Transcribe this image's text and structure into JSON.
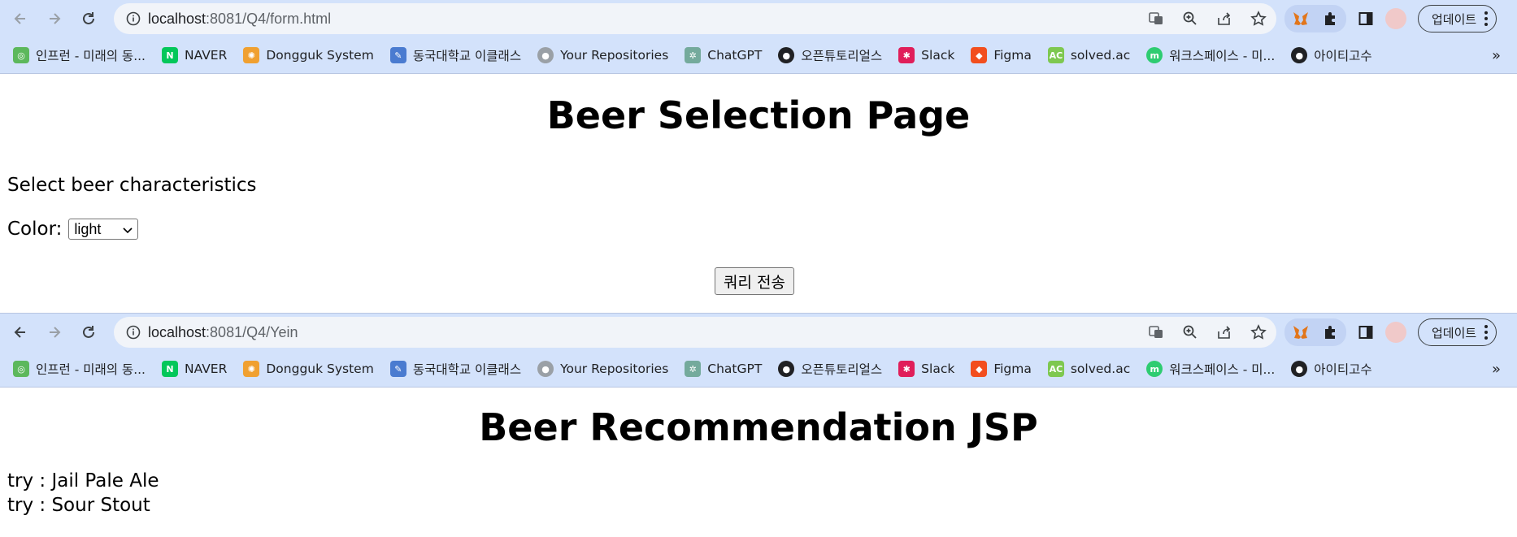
{
  "window1": {
    "url_host": "localhost",
    "url_path": ":8081/Q4/form.html",
    "update_label": "업데이트",
    "page": {
      "heading": "Beer Selection Page",
      "lead": "Select beer characteristics",
      "color_label": "Color:",
      "color_value": "light",
      "submit_label": "쿼리 전송"
    }
  },
  "window2": {
    "url_host": "localhost",
    "url_path": ":8081/Q4/Yein",
    "update_label": "업데이트",
    "page": {
      "heading": "Beer Recommendation JSP",
      "results": [
        "try : Jail Pale Ale",
        "try : Sour Stout"
      ]
    }
  },
  "bookmarks": [
    {
      "label": "인프런 - 미래의 동...",
      "icon": "inflearn-icon",
      "color": "#5cb85c"
    },
    {
      "label": "NAVER",
      "icon": "naver-icon",
      "color": "#03c75a"
    },
    {
      "label": "Dongguk System",
      "icon": "dongguk-icon",
      "color": "#f0a030"
    },
    {
      "label": "동국대학교 이클래스",
      "icon": "eclass-icon",
      "color": "#4a7bd0"
    },
    {
      "label": "Your Repositories",
      "icon": "github-icon",
      "color": "#9aa0a6"
    },
    {
      "label": "ChatGPT",
      "icon": "chatgpt-icon",
      "color": "#74aa9c"
    },
    {
      "label": "오픈튜토리얼스",
      "icon": "globe-icon",
      "color": "#202124"
    },
    {
      "label": "Slack",
      "icon": "slack-icon",
      "color": "#e01e5a"
    },
    {
      "label": "Figma",
      "icon": "figma-icon",
      "color": "#f24e1e"
    },
    {
      "label": "solved.ac",
      "icon": "solvedac-icon",
      "color": "#7ec850"
    },
    {
      "label": "워크스페이스 - 미...",
      "icon": "workspace-icon",
      "color": "#2ecc71"
    },
    {
      "label": "아이티고수",
      "icon": "globe-icon",
      "color": "#202124"
    }
  ],
  "bookmarks_more": "»"
}
